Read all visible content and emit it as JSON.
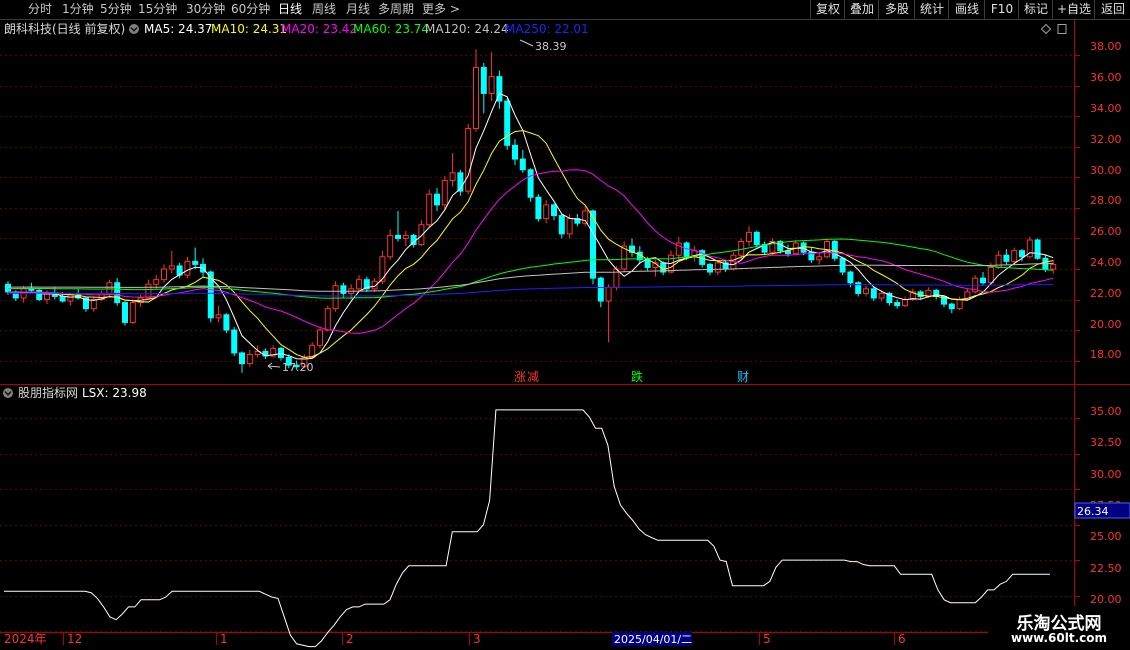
{
  "toolbar": {
    "timeframes": [
      "分时",
      "1分钟",
      "5分钟",
      "15分钟",
      "30分钟",
      "60分钟",
      "日线",
      "周线",
      "月线",
      "多周期",
      "更多 >"
    ],
    "active": "日线",
    "right_buttons": [
      "复权",
      "叠加",
      "多股",
      "统计",
      "画线",
      "F10",
      "+自选",
      "返回"
    ],
    "mark_button": "标记"
  },
  "header": {
    "stock": "朗科科技(日线 前复权)",
    "ma": [
      {
        "label": "MA5: 24.37",
        "color": "#ffffff"
      },
      {
        "label": "MA10: 24.31",
        "color": "#ffff00"
      },
      {
        "label": "MA20: 23.42",
        "color": "#ff00ff"
      },
      {
        "label": "MA60: 23.74",
        "color": "#00ff00"
      },
      {
        "label": "MA120: 24.24",
        "color": "#c0c0c0"
      },
      {
        "label": "MA250: 22.01",
        "color": "#2020ff"
      }
    ]
  },
  "annotations": {
    "high": "38.39",
    "low": "17.20",
    "events": [
      {
        "text": "涨",
        "color": "#ff3030"
      },
      {
        "text": "减",
        "color": "#ff3030"
      },
      {
        "text": "跌",
        "color": "#00ff00"
      },
      {
        "text": "财",
        "color": "#00c8ff"
      }
    ]
  },
  "indicator": {
    "title": "股朋指标网",
    "value_label": "LSX: 23.98",
    "cursor_value": "26.34"
  },
  "axes": {
    "price_ticks": [
      "38.00",
      "36.00",
      "34.00",
      "32.00",
      "30.00",
      "28.00",
      "26.00",
      "24.00",
      "22.00",
      "20.00",
      "18.00"
    ],
    "indicator_ticks": [
      "35.00",
      "32.50",
      "30.00",
      "27.50",
      "25.00",
      "22.50",
      "20.00"
    ],
    "date_labels": [
      "2024年",
      "12",
      "1",
      "2",
      "3",
      "2025/04/01/二",
      "5",
      "6"
    ]
  },
  "watermark": {
    "line1": "乐淘公式网",
    "line2": "www.60lt.com"
  },
  "colors": {
    "up": "#ff3030",
    "down": "#00ffff",
    "axis": "#b00000",
    "lsx": "#ffffff"
  },
  "chart_data": [
    {
      "type": "candlestick",
      "title": "朗科科技(日线 前复权)",
      "ylim": [
        16.4,
        39.0
      ],
      "price_high": 38.39,
      "price_low": 17.2,
      "candles": [
        [
          23.0,
          23.2,
          22.3,
          22.5
        ],
        [
          22.5,
          22.6,
          21.9,
          22.1
        ],
        [
          22.1,
          22.9,
          21.8,
          22.7
        ],
        [
          22.7,
          23.1,
          22.4,
          22.6
        ],
        [
          22.6,
          22.7,
          21.9,
          22.0
        ],
        [
          22.0,
          22.6,
          21.7,
          22.4
        ],
        [
          22.4,
          22.8,
          22.0,
          22.2
        ],
        [
          22.2,
          22.5,
          21.8,
          21.9
        ],
        [
          21.9,
          22.4,
          21.6,
          22.3
        ],
        [
          22.3,
          22.7,
          22.0,
          22.1
        ],
        [
          22.1,
          22.2,
          21.2,
          21.4
        ],
        [
          21.4,
          22.2,
          21.2,
          22.0
        ],
        [
          22.0,
          22.6,
          21.9,
          22.4
        ],
        [
          22.4,
          23.3,
          22.2,
          23.1
        ],
        [
          23.1,
          23.4,
          21.6,
          21.8
        ],
        [
          21.8,
          21.9,
          20.3,
          20.5
        ],
        [
          20.5,
          22.0,
          20.4,
          21.8
        ],
        [
          21.8,
          22.3,
          21.5,
          22.1
        ],
        [
          22.1,
          23.3,
          22.0,
          23.0
        ],
        [
          23.0,
          23.6,
          22.7,
          23.3
        ],
        [
          23.3,
          24.3,
          23.1,
          24.0
        ],
        [
          24.0,
          25.2,
          23.7,
          24.2
        ],
        [
          24.2,
          24.4,
          23.4,
          23.6
        ],
        [
          23.6,
          24.8,
          23.4,
          24.5
        ],
        [
          24.5,
          25.4,
          24.0,
          24.3
        ],
        [
          24.3,
          24.7,
          23.5,
          23.8
        ],
        [
          23.8,
          23.9,
          20.5,
          20.8
        ],
        [
          20.8,
          21.6,
          20.5,
          21.0
        ],
        [
          21.0,
          21.1,
          19.8,
          20.0
        ],
        [
          20.0,
          20.2,
          18.3,
          18.5
        ],
        [
          18.5,
          18.6,
          17.2,
          17.8
        ],
        [
          17.8,
          18.7,
          17.6,
          18.4
        ],
        [
          18.4,
          19.0,
          18.2,
          18.6
        ],
        [
          18.6,
          18.8,
          18.1,
          18.3
        ],
        [
          18.3,
          19.0,
          18.2,
          18.8
        ],
        [
          18.8,
          18.9,
          18.0,
          18.2
        ],
        [
          18.2,
          18.4,
          17.5,
          17.7
        ],
        [
          17.7,
          18.0,
          17.4,
          17.6
        ],
        [
          17.6,
          18.4,
          17.5,
          18.2
        ],
        [
          18.2,
          19.2,
          18.1,
          19.0
        ],
        [
          19.0,
          20.2,
          18.8,
          20.0
        ],
        [
          20.0,
          21.6,
          19.9,
          21.4
        ],
        [
          21.4,
          23.2,
          21.2,
          22.9
        ],
        [
          22.9,
          23.1,
          22.1,
          22.4
        ],
        [
          22.4,
          23.0,
          22.0,
          22.7
        ],
        [
          22.7,
          23.6,
          22.5,
          23.3
        ],
        [
          23.3,
          23.5,
          22.5,
          22.7
        ],
        [
          22.7,
          23.4,
          22.5,
          23.2
        ],
        [
          23.2,
          25.2,
          23.0,
          24.8
        ],
        [
          24.8,
          26.6,
          24.6,
          26.2
        ],
        [
          26.2,
          27.8,
          25.8,
          26.0
        ],
        [
          26.0,
          26.5,
          25.5,
          26.2
        ],
        [
          26.2,
          26.3,
          25.4,
          25.6
        ],
        [
          25.6,
          27.2,
          25.5,
          26.9
        ],
        [
          26.9,
          29.2,
          26.7,
          28.9
        ],
        [
          28.9,
          29.3,
          27.8,
          28.2
        ],
        [
          28.2,
          30.1,
          27.9,
          29.8
        ],
        [
          29.8,
          31.6,
          29.4,
          30.3
        ],
        [
          30.3,
          30.5,
          28.8,
          29.1
        ],
        [
          29.1,
          33.5,
          28.9,
          33.2
        ],
        [
          33.2,
          38.39,
          33.0,
          37.2
        ],
        [
          37.2,
          37.5,
          34.2,
          35.5
        ],
        [
          35.5,
          38.2,
          35.0,
          36.6
        ],
        [
          36.6,
          37.0,
          34.5,
          35.0
        ],
        [
          35.0,
          35.2,
          31.8,
          32.1
        ],
        [
          32.1,
          32.5,
          30.8,
          31.2
        ],
        [
          31.2,
          31.8,
          30.3,
          30.5
        ],
        [
          30.5,
          30.6,
          28.4,
          28.7
        ],
        [
          28.7,
          28.9,
          27.1,
          27.3
        ],
        [
          27.3,
          28.5,
          27.0,
          28.2
        ],
        [
          28.2,
          28.3,
          27.2,
          27.5
        ],
        [
          27.5,
          27.6,
          26.0,
          26.3
        ],
        [
          26.3,
          27.6,
          26.0,
          27.3
        ],
        [
          27.3,
          27.6,
          26.8,
          27.0
        ],
        [
          27.0,
          28.1,
          26.8,
          27.8
        ],
        [
          27.8,
          27.9,
          23.0,
          23.4
        ],
        [
          23.4,
          23.5,
          21.5,
          21.9
        ],
        [
          21.9,
          23.0,
          19.2,
          22.8
        ],
        [
          22.8,
          24.2,
          22.6,
          24.0
        ],
        [
          24.0,
          25.8,
          23.8,
          25.5
        ],
        [
          25.5,
          26.0,
          24.8,
          25.1
        ],
        [
          25.1,
          25.5,
          24.3,
          24.6
        ],
        [
          24.6,
          24.8,
          23.9,
          24.1
        ],
        [
          24.1,
          24.6,
          23.5,
          24.4
        ],
        [
          24.4,
          24.5,
          23.6,
          23.8
        ],
        [
          23.8,
          25.2,
          23.7,
          24.9
        ],
        [
          24.9,
          26.1,
          24.6,
          25.7
        ],
        [
          25.7,
          25.8,
          24.6,
          24.8
        ],
        [
          24.8,
          25.5,
          24.5,
          25.2
        ],
        [
          25.2,
          25.3,
          24.1,
          24.3
        ],
        [
          24.3,
          24.4,
          23.6,
          23.8
        ],
        [
          23.8,
          24.6,
          23.6,
          24.4
        ],
        [
          24.4,
          24.6,
          23.8,
          24.0
        ],
        [
          24.0,
          25.1,
          23.9,
          24.9
        ],
        [
          24.9,
          26.0,
          24.6,
          25.8
        ],
        [
          25.8,
          26.8,
          25.5,
          26.4
        ],
        [
          26.4,
          26.5,
          25.4,
          25.6
        ],
        [
          25.6,
          25.8,
          24.9,
          25.1
        ],
        [
          25.1,
          26.0,
          24.9,
          25.8
        ],
        [
          25.8,
          25.9,
          25.0,
          25.2
        ],
        [
          25.2,
          25.6,
          24.8,
          25.0
        ],
        [
          25.0,
          25.9,
          24.9,
          25.7
        ],
        [
          25.7,
          25.8,
          24.9,
          25.1
        ],
        [
          25.1,
          25.4,
          24.4,
          24.6
        ],
        [
          24.6,
          25.0,
          24.3,
          24.8
        ],
        [
          24.8,
          26.0,
          24.7,
          25.8
        ],
        [
          25.8,
          25.9,
          24.5,
          24.7
        ],
        [
          24.7,
          24.8,
          23.6,
          23.8
        ],
        [
          23.8,
          23.9,
          22.8,
          23.1
        ],
        [
          23.1,
          23.2,
          22.2,
          22.4
        ],
        [
          22.4,
          22.9,
          22.2,
          22.7
        ],
        [
          22.7,
          22.8,
          21.9,
          22.1
        ],
        [
          22.1,
          22.6,
          21.9,
          22.4
        ],
        [
          22.4,
          22.5,
          21.6,
          21.8
        ],
        [
          21.8,
          22.0,
          21.4,
          21.6
        ],
        [
          21.6,
          22.2,
          21.5,
          22.0
        ],
        [
          22.0,
          22.7,
          21.9,
          22.5
        ],
        [
          22.5,
          22.6,
          22.0,
          22.2
        ],
        [
          22.2,
          22.8,
          22.1,
          22.6
        ],
        [
          22.6,
          22.7,
          22.0,
          22.2
        ],
        [
          22.2,
          22.3,
          21.5,
          21.7
        ],
        [
          21.7,
          21.8,
          21.1,
          21.4
        ],
        [
          21.4,
          22.2,
          21.3,
          22.0
        ],
        [
          22.0,
          22.7,
          21.9,
          22.5
        ],
        [
          22.5,
          23.6,
          22.4,
          23.4
        ],
        [
          23.4,
          23.8,
          22.9,
          23.1
        ],
        [
          23.1,
          24.4,
          23.0,
          24.1
        ],
        [
          24.1,
          25.2,
          24.0,
          24.9
        ],
        [
          24.9,
          25.3,
          24.3,
          24.5
        ],
        [
          24.5,
          25.4,
          24.3,
          25.2
        ],
        [
          25.2,
          25.3,
          24.5,
          24.8
        ],
        [
          24.8,
          26.1,
          24.7,
          25.9
        ],
        [
          25.9,
          26.0,
          24.6,
          24.7
        ],
        [
          24.7,
          24.9,
          23.8,
          24.0
        ],
        [
          24.0,
          24.6,
          23.7,
          24.3
        ]
      ],
      "ma_periods": [
        5,
        10,
        20,
        60,
        120,
        250
      ],
      "ma_last": [
        24.37,
        24.31,
        23.42,
        23.74,
        24.24,
        22.01
      ]
    },
    {
      "type": "line",
      "title": "股朋指标网",
      "series": [
        {
          "name": "LSX",
          "values": [
            22.8,
            22.8,
            22.8,
            22.8,
            22.8,
            22.8,
            22.8,
            22.8,
            22.8,
            22.8,
            22.8,
            22.8,
            22.8,
            22.8,
            22.7,
            22.3,
            21.7,
            21.0,
            20.8,
            21.2,
            21.7,
            21.7,
            22.2,
            22.2,
            22.2,
            22.2,
            22.4,
            22.8,
            22.8,
            22.8,
            22.8,
            22.8,
            22.8,
            22.8,
            22.8,
            22.8,
            22.8,
            22.8,
            22.8,
            22.8,
            22.8,
            22.8,
            22.6,
            22.4,
            22.3,
            21.0,
            19.7,
            19.1,
            19.0,
            18.9,
            18.9,
            19.3,
            19.9,
            20.4,
            21.0,
            21.5,
            21.7,
            21.7,
            21.9,
            21.9,
            21.9,
            21.9,
            22.2,
            23.3,
            24.1,
            24.6,
            24.6,
            24.6,
            24.6,
            24.6,
            24.6,
            24.6,
            27.0,
            27.0,
            27.0,
            27.0,
            27.0,
            27.5,
            29.2,
            35.6,
            35.6,
            35.6,
            35.6,
            35.6,
            35.6,
            35.6,
            35.6,
            35.6,
            35.6,
            35.6,
            35.6,
            35.6,
            35.6,
            35.6,
            35.1,
            34.3,
            34.3,
            33.1,
            30.2,
            28.9,
            28.3,
            27.8,
            27.2,
            26.8,
            26.6,
            26.4,
            26.4,
            26.4,
            26.4,
            26.4,
            26.4,
            26.4,
            26.4,
            26.4,
            26.0,
            25.0,
            24.9,
            23.2,
            23.2,
            23.2,
            23.2,
            23.2,
            23.2,
            23.5,
            24.5,
            25.0,
            25.0,
            25.0,
            25.0,
            25.0,
            25.0,
            25.0,
            25.0,
            25.0,
            25.0,
            25.0,
            24.9,
            24.9,
            24.7,
            24.6,
            24.6,
            24.6,
            24.6,
            24.6,
            24.0,
            24.0,
            24.0,
            24.0,
            24.0,
            24.0,
            22.9,
            22.2,
            22.0,
            22.0,
            22.0,
            22.0,
            22.0,
            22.4,
            22.9,
            22.9,
            23.3,
            23.5,
            24.0,
            24.0,
            24.0,
            24.0,
            24.0,
            24.0,
            24.0
          ]
        }
      ],
      "ylim": [
        20.0,
        36.3
      ],
      "last": 23.98
    }
  ]
}
